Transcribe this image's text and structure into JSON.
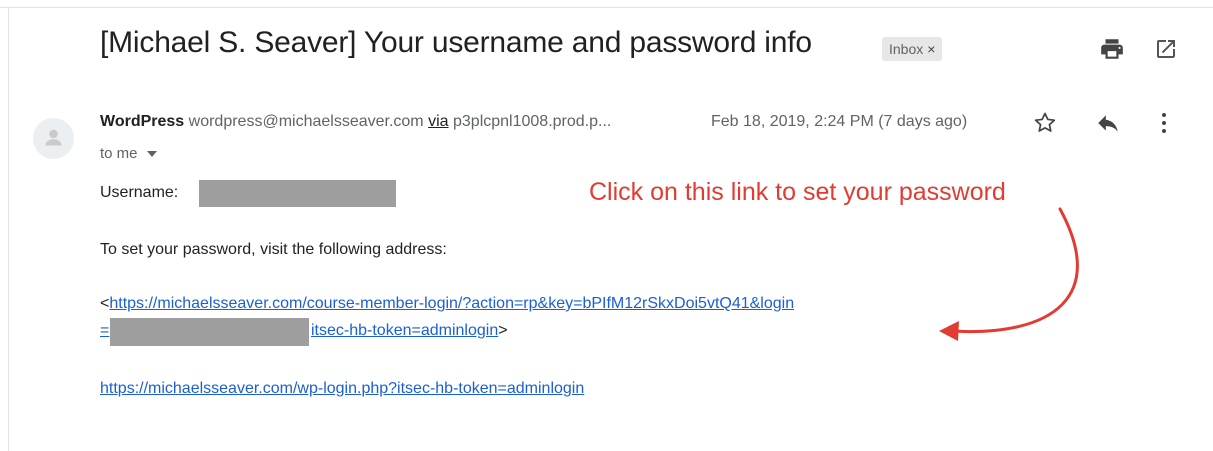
{
  "email": {
    "subject": "[Michael S. Seaver] Your username and password info",
    "label_badge": {
      "text": "Inbox",
      "remove": "×"
    },
    "sender": {
      "name": "WordPress",
      "email": "wordpress@michaelsseaver.com",
      "via_label": "via",
      "via_host": "p3plcpnl1008.prod.p..."
    },
    "date": "Feb 18, 2019, 2:24 PM (7 days ago)",
    "recipient": "to me",
    "body": {
      "username_label": "Username:",
      "instruction": "To set your password, visit the following address:",
      "reset_link_prefix": "<",
      "reset_link_line1": "https://michaelsseaver.com/course-member-login/?action=rp&key=bPIfM12rSkxDoi5vtQ41&login",
      "reset_link_line2_start": "=",
      "reset_link_line2_end": "itsec-hb-token=adminlogin",
      "reset_link_suffix": ">",
      "login_link": "https://michaelsseaver.com/wp-login.php?itsec-hb-token=adminlogin"
    }
  },
  "annotation": {
    "text": "Click on this link to set your password",
    "color": "#e03c31"
  },
  "icons": [
    "print-icon",
    "open-in-new-window-icon",
    "avatar-person-icon",
    "star-icon",
    "reply-icon",
    "more-vertical-icon",
    "chevron-down-icon"
  ]
}
